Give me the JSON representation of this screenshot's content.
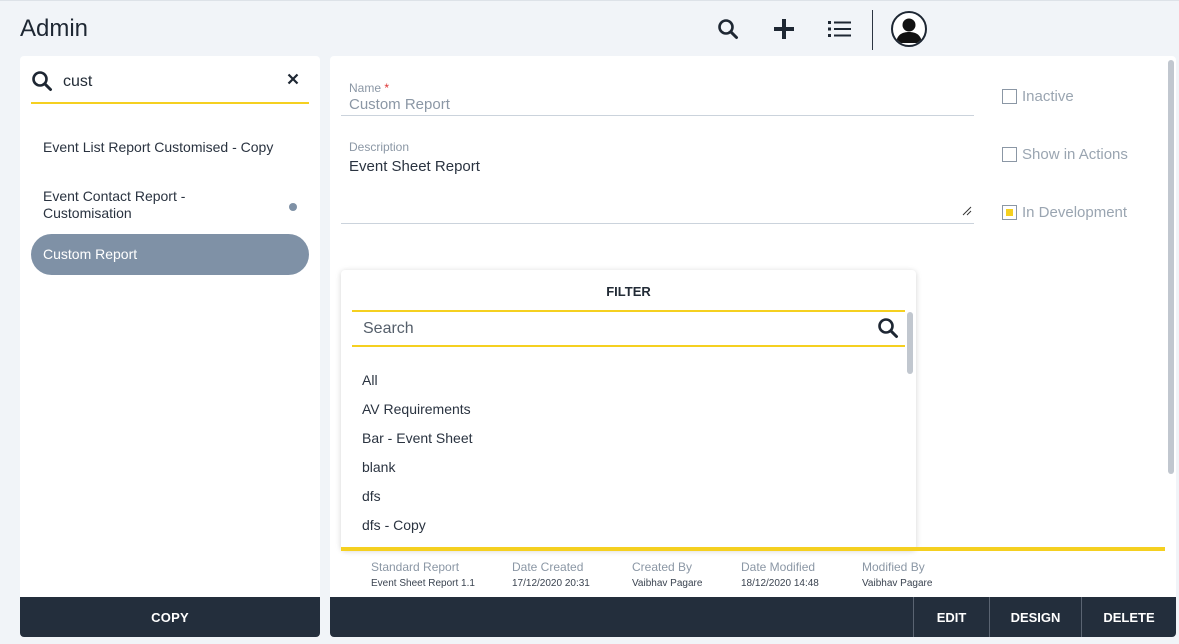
{
  "app": {
    "title": "Admin"
  },
  "topbar": {
    "icons": [
      "search-icon",
      "plus-icon",
      "list-icon",
      "user-avatar-icon"
    ]
  },
  "left": {
    "search_value": "cust",
    "items": [
      {
        "label": "Event List Report Customised - Copy",
        "active": false
      },
      {
        "label": "Event Contact Report - Customisation",
        "active": false,
        "dot": true
      },
      {
        "label": "Custom Report",
        "active": true
      }
    ],
    "copy_label": "COPY"
  },
  "form": {
    "name_label": "Name",
    "name_required": "*",
    "name_value": "Custom Report",
    "description_label": "Description",
    "description_value": "Event Sheet Report",
    "inactive_label": "Inactive",
    "show_in_actions_label": "Show in Actions",
    "in_development_label": "In Development",
    "inactive_checked": false,
    "show_in_actions_checked": false,
    "in_development_checked": true
  },
  "filter": {
    "title": "FILTER",
    "search_placeholder": "Search",
    "options": [
      "All",
      "AV Requirements",
      "Bar - Event Sheet",
      "blank",
      "dfs",
      "dfs - Copy"
    ]
  },
  "meta": {
    "standard_report_label": "Standard Report",
    "standard_report_value": "Event Sheet Report 1.1",
    "date_created_label": "Date Created",
    "date_created_value": "17/12/2020 20:31",
    "created_by_label": "Created By",
    "created_by_value": "Vaibhav Pagare",
    "date_modified_label": "Date Modified",
    "date_modified_value": "18/12/2020 14:48",
    "modified_by_label": "Modified By",
    "modified_by_value": "Vaibhav Pagare"
  },
  "actions": {
    "edit_label": "EDIT",
    "design_label": "DESIGN",
    "delete_label": "DELETE"
  },
  "colors": {
    "accent": "#f5d020",
    "dark_bar": "#232e3c",
    "active_item": "#7f91a6"
  }
}
